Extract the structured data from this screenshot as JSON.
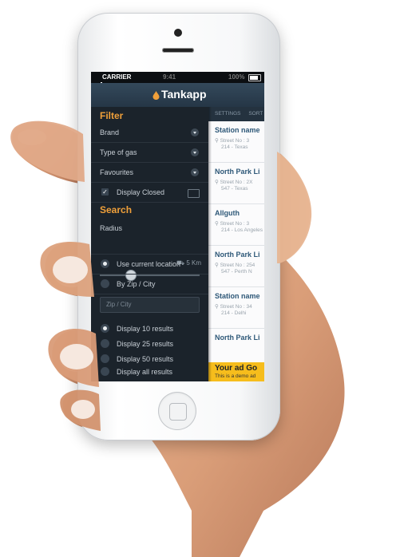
{
  "status_bar": {
    "carrier": "CARRIER",
    "time": "9:41",
    "battery": "100%"
  },
  "app": {
    "title": "Tankapp"
  },
  "filter": {
    "title": "Filter",
    "brand": "Brand",
    "type_of_gas": "Type of gas",
    "favourites": "Favourites",
    "display_closed": "Display Closed"
  },
  "search": {
    "title": "Search",
    "radius_label": "Radius",
    "radius_value": "5 Km",
    "radius_fraction": 0.3,
    "use_current_location": "Use current location",
    "by_zip_city": "By Zip / City",
    "zip_placeholder": "Zip / City",
    "results": [
      "Display 10 results",
      "Display 25 results",
      "Display 50 results",
      "Display all results"
    ]
  },
  "list_header": {
    "settings": "SETTINGS",
    "sort": "SORT"
  },
  "stations": [
    {
      "name": "Station name",
      "street": "Street No : 3",
      "city": "214 - Texas"
    },
    {
      "name": "North Park Li",
      "street": "Street No : 2X",
      "city": "547 - Texas"
    },
    {
      "name": "Allguth",
      "street": "Street No : 3",
      "city": "214 - Los Angeles"
    },
    {
      "name": "North Park Li",
      "street": "Street No : 254",
      "city": "547 - Perth N"
    },
    {
      "name": "Station name",
      "street": "Street No : 34",
      "city": "214 - Delhi"
    }
  ],
  "partial_item": {
    "name": "North Park Li"
  },
  "ad": {
    "title": "Your ad Go",
    "subtitle": "This is a demo ad"
  },
  "colors": {
    "accent": "#f0a03a",
    "drawer": "#1b232b",
    "navbar": "#2c3e50",
    "ad": "#f6bd1c",
    "station_name": "#2e5878"
  }
}
